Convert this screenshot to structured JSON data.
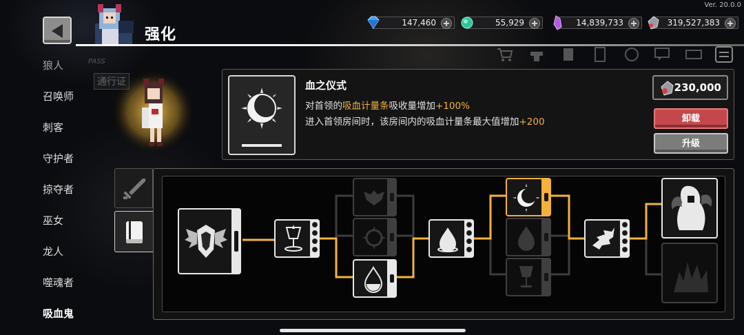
{
  "version": "Ver. 20.0.0",
  "header": {
    "title": "强化"
  },
  "currencies": [
    {
      "name": "diamond",
      "value": "147,460",
      "color": "#3fa3ff"
    },
    {
      "name": "emerald",
      "value": "55,929",
      "color": "#2ec4a0"
    },
    {
      "name": "purple-crystal",
      "value": "14,839,733",
      "color": "#b05ae0"
    },
    {
      "name": "soul-stone",
      "value": "319,527,383",
      "color": "#c84040"
    }
  ],
  "sidebar": {
    "items": [
      {
        "label": "狼人"
      },
      {
        "label": "召唤师"
      },
      {
        "label": "刺客"
      },
      {
        "label": "守护者"
      },
      {
        "label": "掠夺者"
      },
      {
        "label": "巫女"
      },
      {
        "label": "龙人"
      },
      {
        "label": "噬魂者"
      },
      {
        "label": "吸血鬼",
        "active": true
      }
    ]
  },
  "pass_badge": {
    "tag": "PASS",
    "label": "通行证"
  },
  "skill": {
    "name": "血之仪式",
    "desc1_prefix": "对首领的",
    "desc1_highlight": "吸血计量条",
    "desc1_middle": "吸收量增加",
    "desc1_value": "+100%",
    "desc2_text": "进入首领房间时，该房间内的吸血计量条最大值增加",
    "desc2_value": "+200",
    "cost": "230,000",
    "unload_label": "卸载",
    "upgrade_label": "升级"
  },
  "tabs": [
    {
      "name": "weapon",
      "active": false
    },
    {
      "name": "skill-book",
      "active": true
    }
  ],
  "tree": {
    "accent": "#f5b23a",
    "nodes": [
      {
        "id": "root",
        "icon": "winged-crest-icon",
        "state": "active"
      },
      {
        "id": "goblet-1",
        "icon": "blood-goblet-icon",
        "state": "active"
      },
      {
        "id": "bat-1",
        "icon": "bat-silhouette-icon",
        "state": "locked"
      },
      {
        "id": "thorn-1",
        "icon": "thorn-ring-icon",
        "state": "locked"
      },
      {
        "id": "drop-1",
        "icon": "blood-drop-icon",
        "state": "active"
      },
      {
        "id": "drop-2",
        "icon": "blood-drop-icon",
        "state": "active"
      },
      {
        "id": "moon-1",
        "icon": "crescent-moon-icon",
        "state": "selected"
      },
      {
        "id": "drop-3",
        "icon": "blood-drop-icon",
        "state": "locked"
      },
      {
        "id": "goblet-2",
        "icon": "blood-goblet-icon",
        "state": "locked"
      },
      {
        "id": "feather-1",
        "icon": "feather-burst-icon",
        "state": "active"
      },
      {
        "id": "vampire-1",
        "icon": "vampire-lady-icon",
        "state": "active"
      },
      {
        "id": "flame-1",
        "icon": "dark-flame-icon",
        "state": "locked"
      }
    ]
  }
}
